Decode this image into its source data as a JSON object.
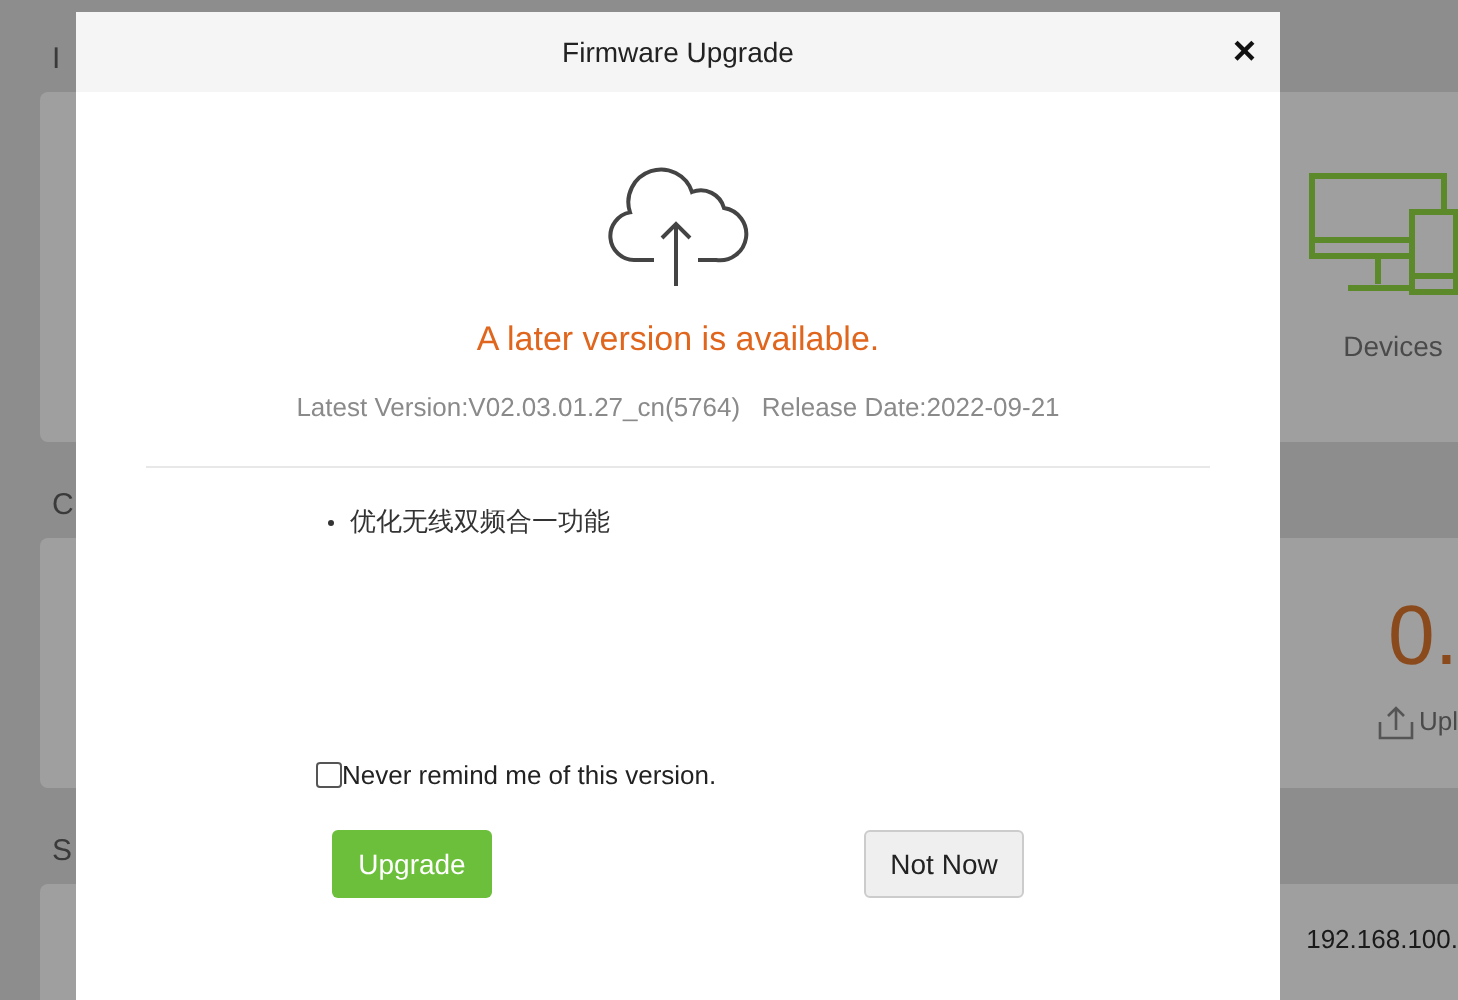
{
  "background": {
    "sections": [
      {
        "heading": "I",
        "card": {
          "kind": "devices",
          "label": "Devices"
        }
      },
      {
        "heading": "C",
        "card": {
          "kind": "stat",
          "value": "0.",
          "label": "Upl"
        }
      },
      {
        "heading": "S",
        "card": {
          "kind": "text",
          "value": "192.168.100."
        }
      }
    ]
  },
  "dialog": {
    "title": "Firmware Upgrade",
    "close": "×",
    "headline": "A later version is available.",
    "version": "Latest Version:V02.03.01.27_cn(5764)",
    "release": "Release Date:2022-09-21",
    "notes": [
      "优化无线双频合一功能"
    ],
    "never_remind": {
      "label": "Never remind me of this version.",
      "checked": false
    },
    "buttons": [
      {
        "kind": "primary",
        "label": "Upgrade"
      },
      {
        "kind": "secondary",
        "label": "Not Now"
      }
    ]
  }
}
